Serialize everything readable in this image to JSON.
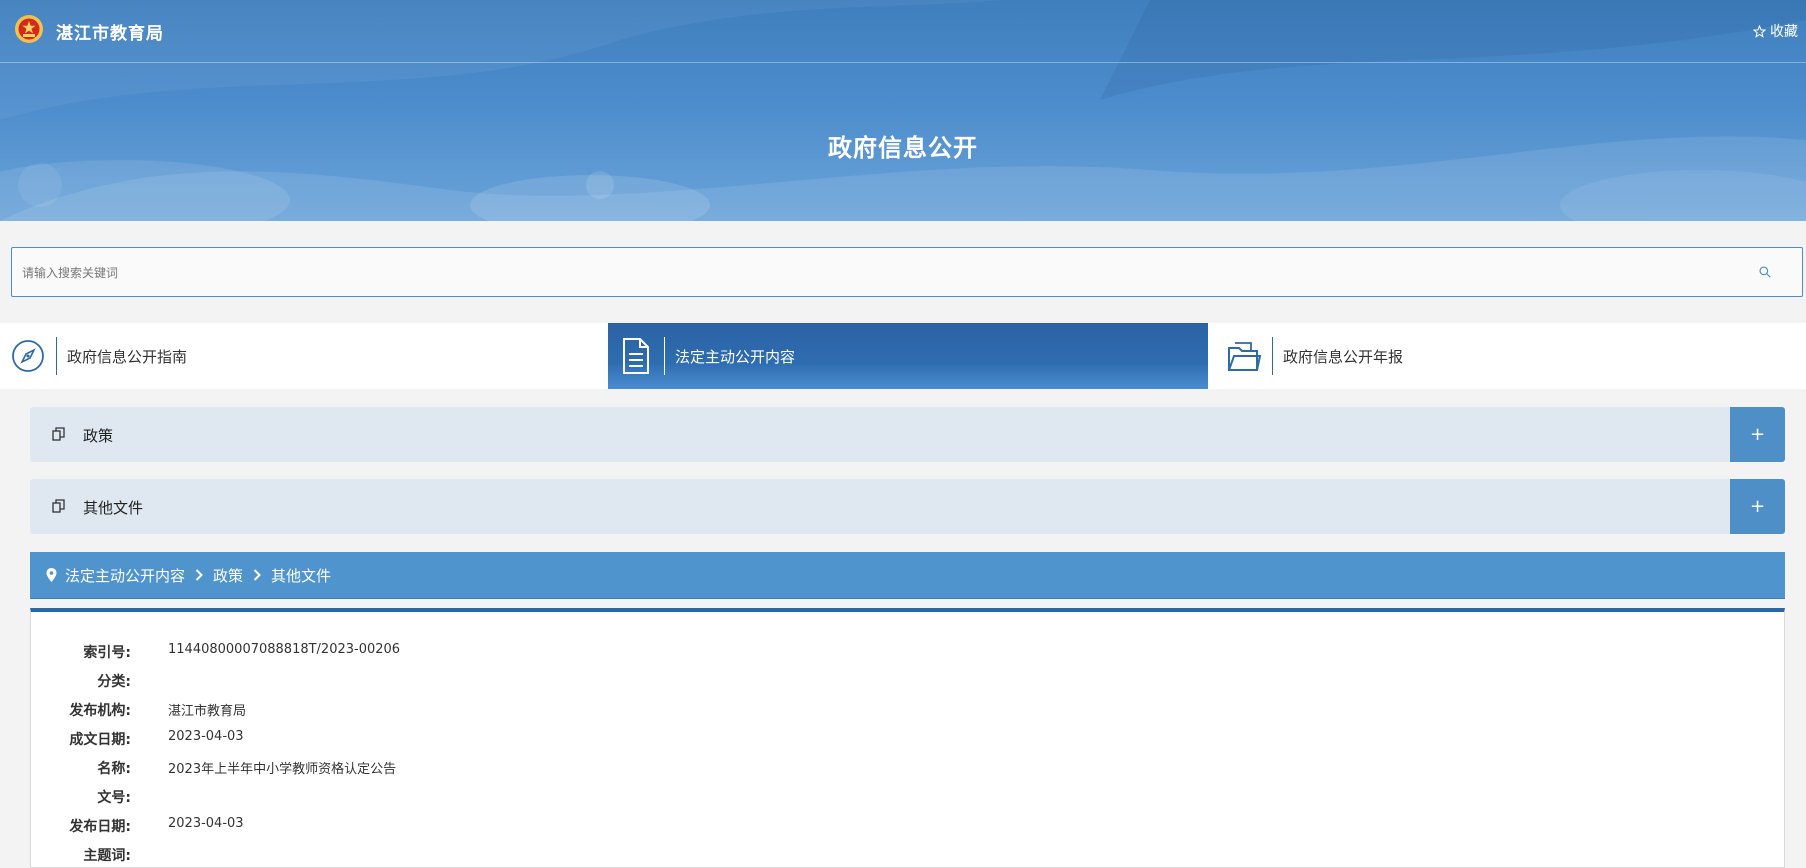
{
  "header": {
    "site_title": "湛江市教育局",
    "favorite_label": "收藏",
    "page_title": "政府信息公开"
  },
  "search": {
    "placeholder": "请输入搜索关键词",
    "value": ""
  },
  "nav": {
    "items": [
      {
        "label": "政府信息公开指南",
        "icon": "compass-icon"
      },
      {
        "label": "法定主动公开内容",
        "icon": "document-icon",
        "active": true
      },
      {
        "label": "政府信息公开年报",
        "icon": "folder-icon"
      }
    ]
  },
  "accordion": [
    {
      "label": "政策",
      "toggle": "+"
    },
    {
      "label": "其他文件",
      "toggle": "+"
    }
  ],
  "breadcrumb": [
    "法定主动公开内容",
    "政策",
    "其他文件"
  ],
  "detail": {
    "fields": [
      {
        "label": "索引号:",
        "value": "11440800007088818T/2023-00206"
      },
      {
        "label": "分类:",
        "value": ""
      },
      {
        "label": "发布机构:",
        "value": "湛江市教育局"
      },
      {
        "label": "成文日期:",
        "value": "2023-04-03"
      },
      {
        "label": "名称:",
        "value": "2023年上半年中小学教师资格认定公告"
      },
      {
        "label": "文号:",
        "value": ""
      },
      {
        "label": "发布日期:",
        "value": "2023-04-03"
      },
      {
        "label": "主题词:",
        "value": ""
      }
    ]
  },
  "colors": {
    "primary": "#2a67a6",
    "accent": "#4f8fc8",
    "accordion_bg": "#dfe8f0"
  }
}
